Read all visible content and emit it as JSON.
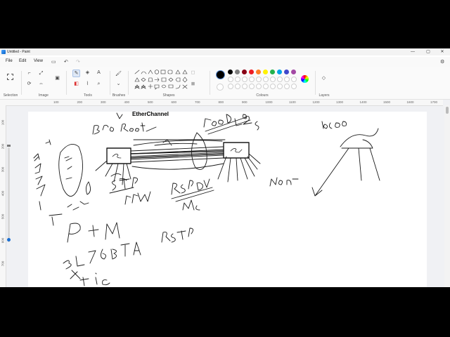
{
  "window": {
    "title": "Untitled - Paint",
    "controls": {
      "minimize": "—",
      "maximize": "▢",
      "close": "✕"
    }
  },
  "menu": {
    "items": [
      "File",
      "Edit",
      "View"
    ],
    "icons": [
      "save-icon",
      "undo-icon",
      "redo-icon"
    ],
    "settings_icon": "gear-icon"
  },
  "ribbon": {
    "groups": [
      "Selection",
      "Image",
      "Tools",
      "Brushes",
      "Shapes",
      "Colours",
      "Layers"
    ],
    "palette": {
      "row1": [
        "#000000",
        "#7f7f7f",
        "#880015",
        "#ed1c24",
        "#ff7f27",
        "#fff200",
        "#22b14c",
        "#00a2e8",
        "#3f48cc",
        "#a349a4"
      ],
      "row2": [
        "#ffffff",
        "#c3c3c3",
        "#b97a57",
        "#ffaec9",
        "#ffc90e",
        "#efe4b0",
        "#b5e61d",
        "#99d9ea",
        "#7092be",
        "#c8bfe7"
      ],
      "primary": "#000000",
      "secondary": "#ffffff"
    }
  },
  "rulers": {
    "horizontal": [
      "100",
      "200",
      "300",
      "400",
      "500",
      "600",
      "700",
      "800",
      "900",
      "1000",
      "1100",
      "1200",
      "1300",
      "1400",
      "1500",
      "1600",
      "1700"
    ],
    "vertical": [
      "100",
      "200",
      "300",
      "400",
      "500",
      "600",
      "700"
    ]
  },
  "canvas": {
    "typed_text": "EtherChannel"
  }
}
